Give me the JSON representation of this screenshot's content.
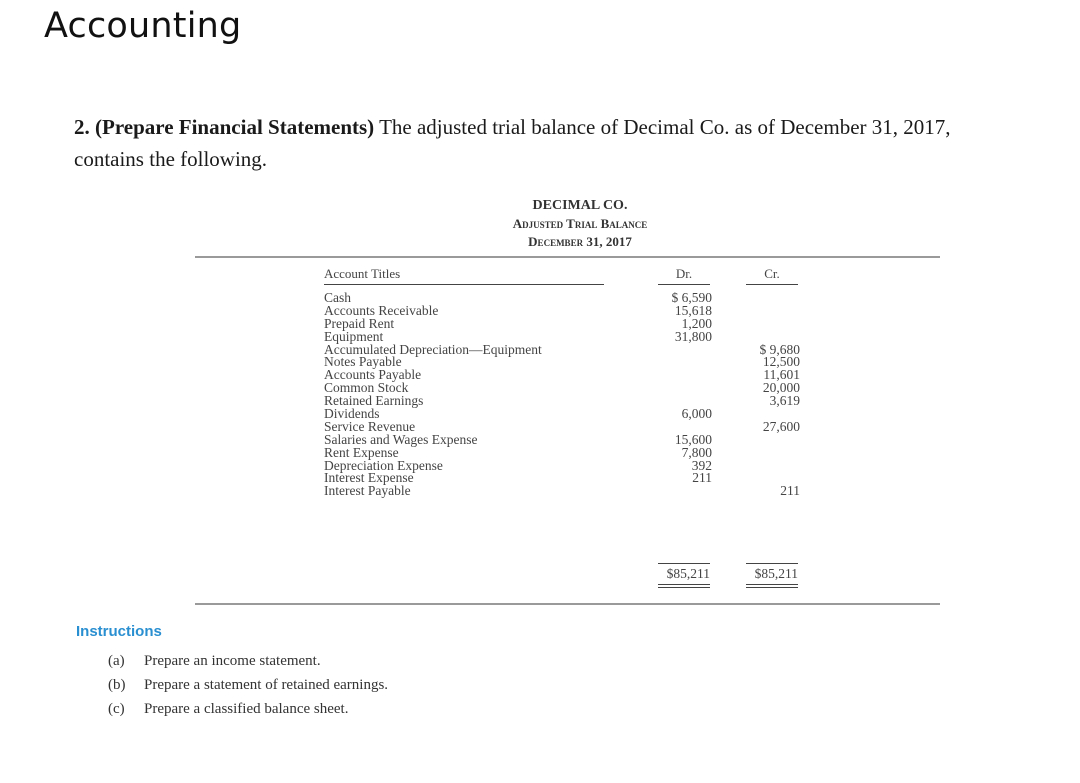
{
  "app": {
    "title": "Accounting"
  },
  "problem": {
    "number": "2.",
    "heading": "(Prepare Financial Statements)",
    "text": "The adjusted trial balance of Decimal Co. as of December 31, 2017, contains the following."
  },
  "trial_balance": {
    "company": "DECIMAL CO.",
    "statement": "Adjusted Trial Balance",
    "date": "December 31, 2017",
    "headers": {
      "titles": "Account Titles",
      "dr": "Dr.",
      "cr": "Cr."
    },
    "rows": [
      {
        "title": "Cash",
        "dr": "$ 6,590",
        "cr": ""
      },
      {
        "title": "Accounts Receivable",
        "dr": "15,618",
        "cr": ""
      },
      {
        "title": "Prepaid Rent",
        "dr": "1,200",
        "cr": ""
      },
      {
        "title": "Equipment",
        "dr": "31,800",
        "cr": ""
      },
      {
        "title": "Accumulated Depreciation—Equipment",
        "dr": "",
        "cr": "$ 9,680"
      },
      {
        "title": "Notes Payable",
        "dr": "",
        "cr": "12,500"
      },
      {
        "title": "Accounts Payable",
        "dr": "",
        "cr": "11,601"
      },
      {
        "title": "Common Stock",
        "dr": "",
        "cr": "20,000"
      },
      {
        "title": "Retained Earnings",
        "dr": "",
        "cr": "3,619"
      },
      {
        "title": "Dividends",
        "dr": "6,000",
        "cr": ""
      },
      {
        "title": "Service Revenue",
        "dr": "",
        "cr": "27,600"
      },
      {
        "title": "Salaries and Wages Expense",
        "dr": "15,600",
        "cr": ""
      },
      {
        "title": "Rent Expense",
        "dr": "7,800",
        "cr": ""
      },
      {
        "title": "Depreciation Expense",
        "dr": "392",
        "cr": ""
      },
      {
        "title": "Interest Expense",
        "dr": "211",
        "cr": ""
      },
      {
        "title": "Interest Payable",
        "dr": "",
        "cr": "211"
      }
    ],
    "totals": {
      "dr": "$85,211",
      "cr": "$85,211"
    }
  },
  "instructions": {
    "title": "Instructions",
    "items": [
      {
        "letter": "(a)",
        "text": "Prepare an income statement."
      },
      {
        "letter": "(b)",
        "text": "Prepare a statement of retained earnings."
      },
      {
        "letter": "(c)",
        "text": "Prepare a classified balance sheet."
      }
    ]
  }
}
